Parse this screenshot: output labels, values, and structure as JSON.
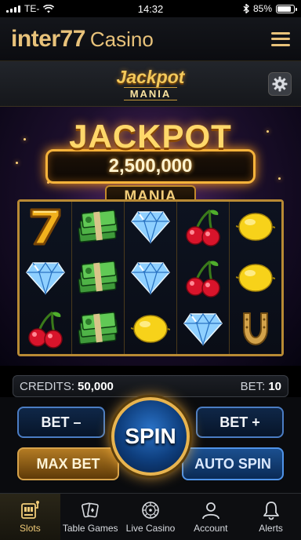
{
  "status_bar": {
    "carrier": "TE-",
    "time": "14:32",
    "battery_percent": "85%",
    "battery_level": 0.85
  },
  "header": {
    "brand_main": "inter77",
    "brand_sub": "Casino",
    "menu_icon": "hamburger-icon"
  },
  "game": {
    "logo_top": "Jackpot",
    "logo_bottom": "MANIA",
    "settings_icon": "gear-icon"
  },
  "jackpot": {
    "title": "JACKPOT",
    "amount": "2,500,000",
    "subtitle": "MANIA"
  },
  "reels": [
    [
      "seven",
      "diamond",
      "cherry"
    ],
    [
      "cash",
      "cash",
      "cash"
    ],
    [
      "diamond",
      "diamond",
      "lemon"
    ],
    [
      "cherry",
      "cherry",
      "diamond"
    ],
    [
      "lemon",
      "lemon",
      "horseshoe"
    ]
  ],
  "info": {
    "credits_label": "CREDITS:",
    "credits_value": "50,000",
    "bet_label": "BET:",
    "bet_value": "10"
  },
  "controls": {
    "bet_minus": "BET –",
    "bet_plus": "BET +",
    "spin": "SPIN",
    "max_bet": "MAX BET",
    "auto_spin": "AUTO SPIN"
  },
  "nav": [
    {
      "label": "Slots",
      "icon": "slot-machine-icon",
      "active": true
    },
    {
      "label": "Table Games",
      "icon": "cards-icon",
      "active": false
    },
    {
      "label": "Live Casino",
      "icon": "roulette-icon",
      "active": false
    },
    {
      "label": "Account",
      "icon": "user-icon",
      "active": false
    },
    {
      "label": "Alerts",
      "icon": "bell-icon",
      "active": false
    }
  ],
  "colors": {
    "gold": "#e8c27a",
    "blue": "#2a72c7",
    "background": "#0a0b0e"
  }
}
